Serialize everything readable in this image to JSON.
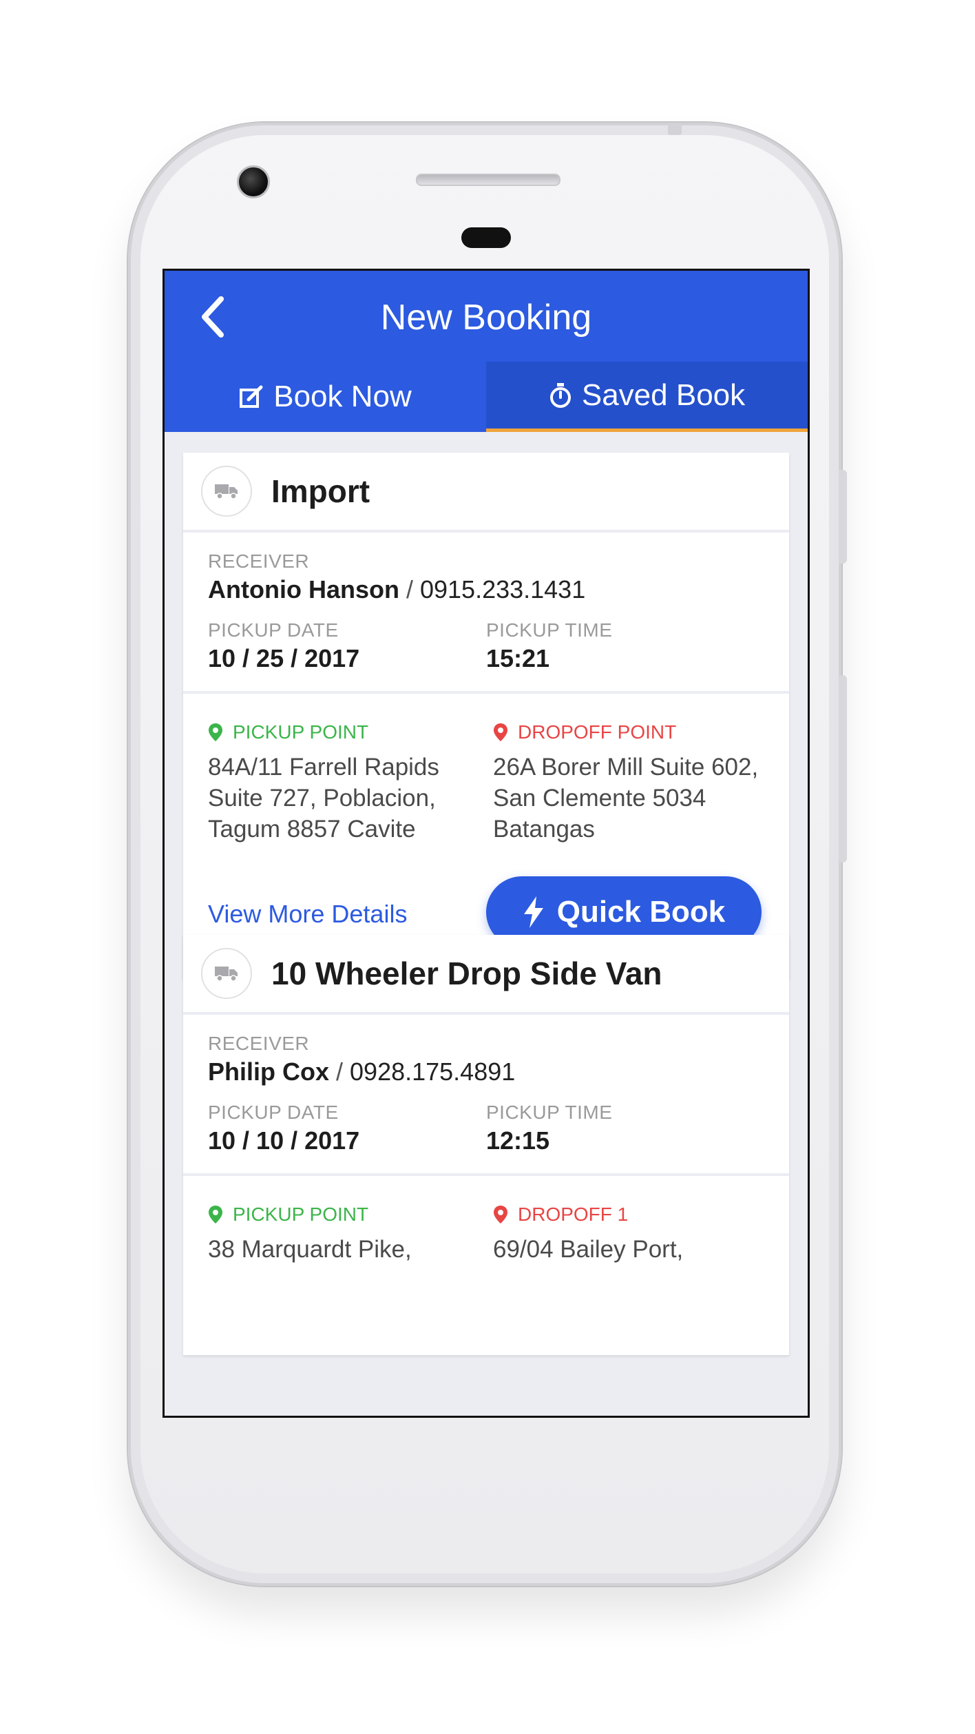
{
  "header": {
    "title": "New Booking"
  },
  "tabs": [
    {
      "label": "Book Now",
      "icon": "edit-icon",
      "active": false
    },
    {
      "label": "Saved Book",
      "icon": "stopwatch-icon",
      "active": true
    }
  ],
  "bookings": [
    {
      "title": "Import",
      "receiver_label": "RECEIVER",
      "receiver_name": "Antonio Hanson",
      "receiver_separator": " / ",
      "receiver_phone": "0915.233.1431",
      "pickup_date_label": "PICKUP DATE",
      "pickup_date": "10 / 25 / 2017",
      "pickup_time_label": "PICKUP TIME",
      "pickup_time": "15:21",
      "pickup_point_label": "PICKUP POINT",
      "pickup_address": "84A/11 Farrell Rapids Suite 727, Poblacion, Tagum 8857 Cavite",
      "dropoff_label": "DROPOFF POINT",
      "dropoff_address": "26A Borer Mill Suite 602, San Clemente 5034 Batangas",
      "more_link": "View More Details",
      "quick_book": "Quick Book"
    },
    {
      "title": "10 Wheeler Drop Side Van",
      "receiver_label": "RECEIVER",
      "receiver_name": "Philip Cox",
      "receiver_separator": " / ",
      "receiver_phone": "0928.175.4891",
      "pickup_date_label": "PICKUP DATE",
      "pickup_date": "10 / 10 / 2017",
      "pickup_time_label": "PICKUP TIME",
      "pickup_time": "12:15",
      "pickup_point_label": "PICKUP POINT",
      "pickup_address": "38 Marquardt Pike,",
      "dropoff_label": "DROPOFF 1",
      "dropoff_address": "69/04 Bailey Port,"
    }
  ],
  "colors": {
    "primary": "#2c5ae0",
    "tab_indicator": "#f0a43a",
    "pickup_green": "#3bb54a",
    "dropoff_red": "#e84545"
  }
}
